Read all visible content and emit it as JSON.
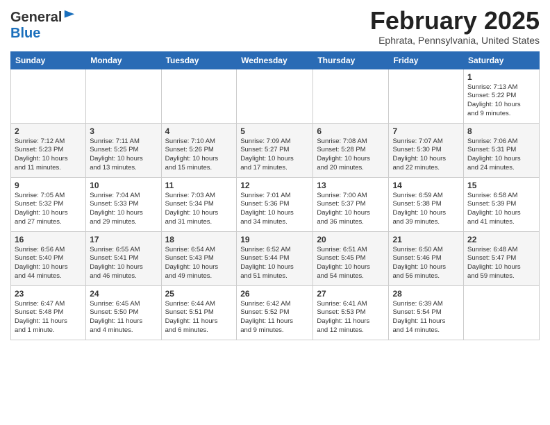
{
  "header": {
    "logo_general": "General",
    "logo_blue": "Blue",
    "month": "February 2025",
    "location": "Ephrata, Pennsylvania, United States"
  },
  "weekdays": [
    "Sunday",
    "Monday",
    "Tuesday",
    "Wednesday",
    "Thursday",
    "Friday",
    "Saturday"
  ],
  "weeks": [
    [
      {
        "day": "",
        "info": ""
      },
      {
        "day": "",
        "info": ""
      },
      {
        "day": "",
        "info": ""
      },
      {
        "day": "",
        "info": ""
      },
      {
        "day": "",
        "info": ""
      },
      {
        "day": "",
        "info": ""
      },
      {
        "day": "1",
        "info": "Sunrise: 7:13 AM\nSunset: 5:22 PM\nDaylight: 10 hours\nand 9 minutes."
      }
    ],
    [
      {
        "day": "2",
        "info": "Sunrise: 7:12 AM\nSunset: 5:23 PM\nDaylight: 10 hours\nand 11 minutes."
      },
      {
        "day": "3",
        "info": "Sunrise: 7:11 AM\nSunset: 5:25 PM\nDaylight: 10 hours\nand 13 minutes."
      },
      {
        "day": "4",
        "info": "Sunrise: 7:10 AM\nSunset: 5:26 PM\nDaylight: 10 hours\nand 15 minutes."
      },
      {
        "day": "5",
        "info": "Sunrise: 7:09 AM\nSunset: 5:27 PM\nDaylight: 10 hours\nand 17 minutes."
      },
      {
        "day": "6",
        "info": "Sunrise: 7:08 AM\nSunset: 5:28 PM\nDaylight: 10 hours\nand 20 minutes."
      },
      {
        "day": "7",
        "info": "Sunrise: 7:07 AM\nSunset: 5:30 PM\nDaylight: 10 hours\nand 22 minutes."
      },
      {
        "day": "8",
        "info": "Sunrise: 7:06 AM\nSunset: 5:31 PM\nDaylight: 10 hours\nand 24 minutes."
      }
    ],
    [
      {
        "day": "9",
        "info": "Sunrise: 7:05 AM\nSunset: 5:32 PM\nDaylight: 10 hours\nand 27 minutes."
      },
      {
        "day": "10",
        "info": "Sunrise: 7:04 AM\nSunset: 5:33 PM\nDaylight: 10 hours\nand 29 minutes."
      },
      {
        "day": "11",
        "info": "Sunrise: 7:03 AM\nSunset: 5:34 PM\nDaylight: 10 hours\nand 31 minutes."
      },
      {
        "day": "12",
        "info": "Sunrise: 7:01 AM\nSunset: 5:36 PM\nDaylight: 10 hours\nand 34 minutes."
      },
      {
        "day": "13",
        "info": "Sunrise: 7:00 AM\nSunset: 5:37 PM\nDaylight: 10 hours\nand 36 minutes."
      },
      {
        "day": "14",
        "info": "Sunrise: 6:59 AM\nSunset: 5:38 PM\nDaylight: 10 hours\nand 39 minutes."
      },
      {
        "day": "15",
        "info": "Sunrise: 6:58 AM\nSunset: 5:39 PM\nDaylight: 10 hours\nand 41 minutes."
      }
    ],
    [
      {
        "day": "16",
        "info": "Sunrise: 6:56 AM\nSunset: 5:40 PM\nDaylight: 10 hours\nand 44 minutes."
      },
      {
        "day": "17",
        "info": "Sunrise: 6:55 AM\nSunset: 5:41 PM\nDaylight: 10 hours\nand 46 minutes."
      },
      {
        "day": "18",
        "info": "Sunrise: 6:54 AM\nSunset: 5:43 PM\nDaylight: 10 hours\nand 49 minutes."
      },
      {
        "day": "19",
        "info": "Sunrise: 6:52 AM\nSunset: 5:44 PM\nDaylight: 10 hours\nand 51 minutes."
      },
      {
        "day": "20",
        "info": "Sunrise: 6:51 AM\nSunset: 5:45 PM\nDaylight: 10 hours\nand 54 minutes."
      },
      {
        "day": "21",
        "info": "Sunrise: 6:50 AM\nSunset: 5:46 PM\nDaylight: 10 hours\nand 56 minutes."
      },
      {
        "day": "22",
        "info": "Sunrise: 6:48 AM\nSunset: 5:47 PM\nDaylight: 10 hours\nand 59 minutes."
      }
    ],
    [
      {
        "day": "23",
        "info": "Sunrise: 6:47 AM\nSunset: 5:48 PM\nDaylight: 11 hours\nand 1 minute."
      },
      {
        "day": "24",
        "info": "Sunrise: 6:45 AM\nSunset: 5:50 PM\nDaylight: 11 hours\nand 4 minutes."
      },
      {
        "day": "25",
        "info": "Sunrise: 6:44 AM\nSunset: 5:51 PM\nDaylight: 11 hours\nand 6 minutes."
      },
      {
        "day": "26",
        "info": "Sunrise: 6:42 AM\nSunset: 5:52 PM\nDaylight: 11 hours\nand 9 minutes."
      },
      {
        "day": "27",
        "info": "Sunrise: 6:41 AM\nSunset: 5:53 PM\nDaylight: 11 hours\nand 12 minutes."
      },
      {
        "day": "28",
        "info": "Sunrise: 6:39 AM\nSunset: 5:54 PM\nDaylight: 11 hours\nand 14 minutes."
      },
      {
        "day": "",
        "info": ""
      }
    ]
  ]
}
